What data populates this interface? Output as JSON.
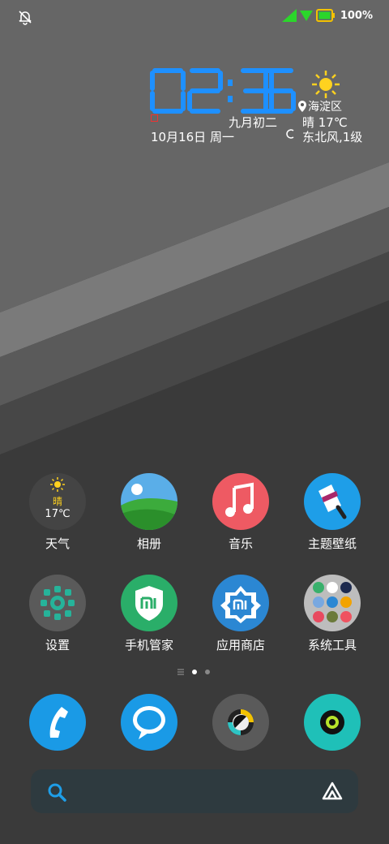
{
  "colors": {
    "clock": "#1e90ff",
    "signal": "#2bd62b",
    "battery": "#f2c200"
  },
  "status": {
    "battery_text": "100%",
    "icons": [
      "mute-icon",
      "signal-icon",
      "wifi-icon",
      "battery-icon"
    ]
  },
  "widget": {
    "time": "02:36",
    "location": "海淀区",
    "lunar": "九月初二",
    "date": "10月16日 周一",
    "weather": "晴 17℃",
    "wind": "东北风,1级"
  },
  "apps": [
    {
      "label": "天气",
      "icon": "weather-icon",
      "cond": "晴",
      "temp": "17℃"
    },
    {
      "label": "相册",
      "icon": "gallery-icon"
    },
    {
      "label": "音乐",
      "icon": "music-icon"
    },
    {
      "label": "主题壁纸",
      "icon": "theme-icon"
    },
    {
      "label": "设置",
      "icon": "settings-icon"
    },
    {
      "label": "手机管家",
      "icon": "security-icon"
    },
    {
      "label": "应用商店",
      "icon": "app-store-icon"
    },
    {
      "label": "系统工具",
      "icon": "tools-folder-icon"
    }
  ],
  "dock": [
    "phone-icon",
    "messages-icon",
    "browser-icon",
    "camera-icon"
  ],
  "search": {
    "icons": [
      "search-icon",
      "assistant-icon"
    ]
  }
}
